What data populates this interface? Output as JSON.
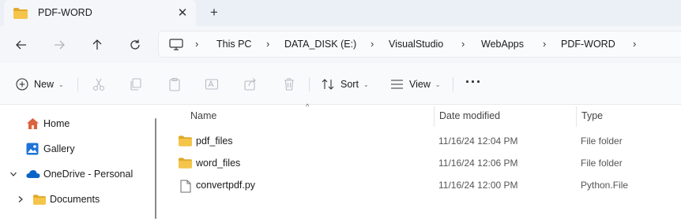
{
  "window": {
    "tab_title": "PDF-WORD",
    "tab_close": "✕",
    "new_tab": "+"
  },
  "nav": {
    "breadcrumbs": [
      {
        "label": "This PC"
      },
      {
        "label": "DATA_DISK (E:)"
      },
      {
        "label": "VisualStudio"
      },
      {
        "label": "WebApps"
      },
      {
        "label": "PDF-WORD"
      }
    ],
    "separator": "›"
  },
  "toolbar": {
    "new_label": "New",
    "sort_label": "Sort",
    "view_label": "View",
    "more_label": "···",
    "caret": "⌄"
  },
  "sidebar": {
    "items": [
      {
        "label": "Home",
        "icon": "home-icon"
      },
      {
        "label": "Gallery",
        "icon": "gallery-icon"
      },
      {
        "label": "OneDrive - Personal",
        "icon": "cloud-icon",
        "expanded": true
      },
      {
        "label": "Documents",
        "icon": "folder-icon",
        "expanded": false
      }
    ]
  },
  "files": {
    "columns": {
      "name": "Name",
      "date": "Date modified",
      "type": "Type"
    },
    "sort_indicator": "^",
    "rows": [
      {
        "name": "pdf_files",
        "date": "11/16/24 12:04 PM",
        "type": "File folder",
        "icon": "folder-icon"
      },
      {
        "name": "word_files",
        "date": "11/16/24 12:06 PM",
        "type": "File folder",
        "icon": "folder-icon"
      },
      {
        "name": "convertpdf.py",
        "date": "11/16/24 12:00 PM",
        "type": "Python.File",
        "icon": "file-icon"
      }
    ]
  },
  "colors": {
    "folder": "#f4c54a",
    "folder_dark": "#e0a92a",
    "onedrive": "#0a64c8",
    "home": "#d9633f",
    "accent": "#0067c0"
  }
}
